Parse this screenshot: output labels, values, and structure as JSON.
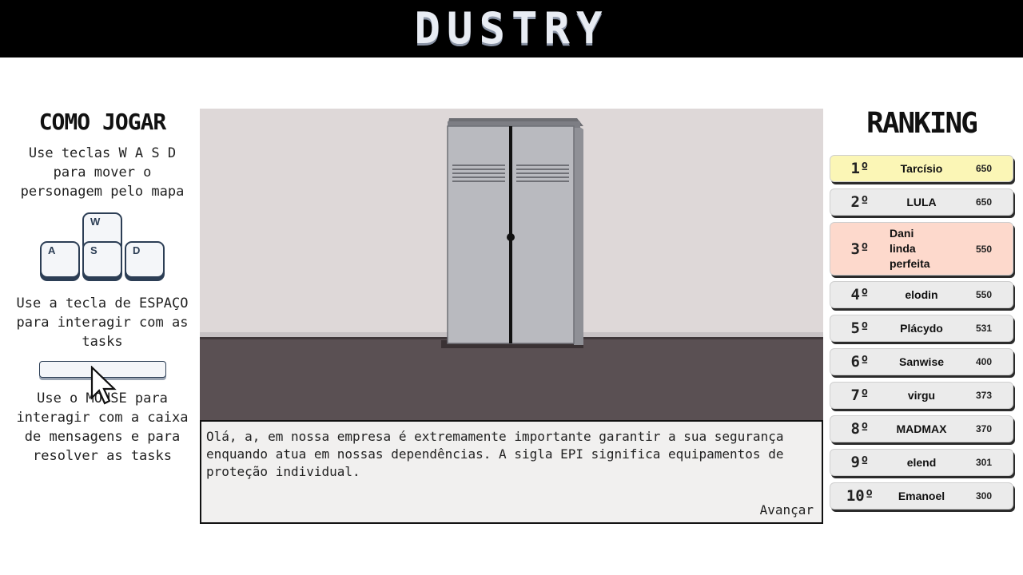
{
  "header": {
    "title": "DUSTRY"
  },
  "how_to_play": {
    "title": "COMO JOGAR",
    "move_text": "Use teclas W A S D para mover o personagem pelo mapa",
    "keys": [
      "W",
      "A",
      "S",
      "D"
    ],
    "space_text": "Use a tecla de ESPAÇO para interagir com as tasks",
    "mouse_text": "Use o MOUSE para interagir com a caixa de mensagens e para resolver as tasks"
  },
  "dialog": {
    "text": "Olá, a, em nossa empresa é extremamente importante garantir a sua segurança enquando atua em nossas dependências. A sigla EPI significa equipamentos de proteção individual.",
    "next_label": "Avançar"
  },
  "ranking": {
    "title": "RANKING",
    "entries": [
      {
        "pos": "1º",
        "name": "Tarcísio",
        "score": "650",
        "color": "#fbf6b6"
      },
      {
        "pos": "2º",
        "name": "LULA",
        "score": "650",
        "color": "#ebebeb"
      },
      {
        "pos": "3º",
        "name": "Dani linda perfeita",
        "score": "550",
        "color": "#fdd9cc"
      },
      {
        "pos": "4º",
        "name": "elodin",
        "score": "550",
        "color": "#ebebeb"
      },
      {
        "pos": "5º",
        "name": "Plácydo",
        "score": "531",
        "color": "#ebebeb"
      },
      {
        "pos": "6º",
        "name": "Sanwise",
        "score": "400",
        "color": "#ebebeb"
      },
      {
        "pos": "7º",
        "name": "virgu",
        "score": "373",
        "color": "#ebebeb"
      },
      {
        "pos": "8º",
        "name": "MADMAX",
        "score": "370",
        "color": "#ebebeb"
      },
      {
        "pos": "9º",
        "name": "elend",
        "score": "301",
        "color": "#ebebeb"
      },
      {
        "pos": "10º",
        "name": "Emanoel",
        "score": "300",
        "color": "#ebebeb"
      }
    ]
  },
  "colors": {
    "header_bg": "#000000",
    "wall": "#ded8d8",
    "floor": "#5a5053",
    "locker": "#b9babf"
  }
}
